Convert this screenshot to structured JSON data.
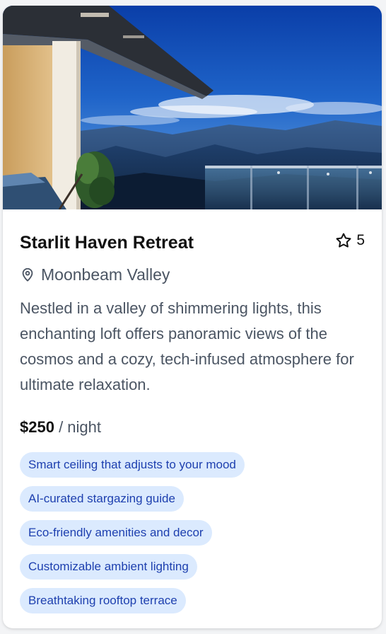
{
  "listing": {
    "title": "Starlit Haven Retreat",
    "rating": "5",
    "location": "Moonbeam Valley",
    "description": "Nestled in a valley of shimmering lights, this enchanting loft offers panoramic views of the cosmos and a cozy, tech-infused atmosphere for ultimate relaxation.",
    "price": "$250",
    "price_unit": "/ night",
    "features": [
      "Smart ceiling that adjusts to your mood",
      "AI-curated stargazing guide",
      "Eco-friendly amenities and decor",
      "Customizable ambient lighting",
      "Breathtaking rooftop terrace"
    ]
  },
  "icons": {
    "rating": "star-icon",
    "location": "map-pin-icon"
  },
  "colors": {
    "chip_background": "#dbeafe",
    "chip_text": "#1e40af",
    "muted_text": "#4b5563"
  }
}
